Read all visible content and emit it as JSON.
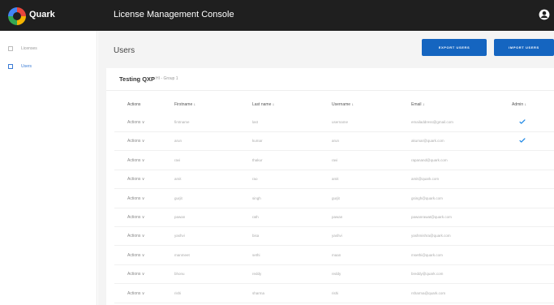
{
  "header": {
    "brand": "Quark",
    "title": "License Management Console"
  },
  "sidebar": {
    "items": [
      {
        "label": "Licenses"
      },
      {
        "label": "Users"
      }
    ]
  },
  "main": {
    "title": "Users",
    "export_label": "EXPORT USERS",
    "import_label": "IMPORT USERS"
  },
  "card": {
    "title": "Testing QXP",
    "subtitle": "HI - Group 1"
  },
  "table": {
    "columns": [
      "Actions",
      "Firstname ↓",
      "Last name ↓",
      "Username ↓",
      "Email ↓",
      "Admin ↓"
    ],
    "rows": [
      {
        "action": "Actions ∨",
        "first": "firstname",
        "last": "last",
        "user": "username",
        "email": "emailaddress@gmail.com",
        "admin": true
      },
      {
        "action": "Actions ∨",
        "first": "arun",
        "last": "kumar",
        "user": "arun",
        "email": "akumar@quark.com",
        "admin": true
      },
      {
        "action": "Actions ∨",
        "first": "ravi",
        "last": "thakur",
        "user": "ravi",
        "email": "rapanand@quark.com",
        "admin": false
      },
      {
        "action": "Actions ∨",
        "first": "amit",
        "last": "rao",
        "user": "amit",
        "email": "amit@quark.com",
        "admin": false
      },
      {
        "action": "Actions ∨",
        "first": "gurjit",
        "last": "singh",
        "user": "gurjit",
        "email": "gsingh@quark.com",
        "admin": false
      },
      {
        "action": "Actions ∨",
        "first": "pawan",
        "last": "rath",
        "user": "pawan",
        "email": "pawanrawat@quark.com",
        "admin": false
      },
      {
        "action": "Actions ∨",
        "first": "yashvi",
        "last": "bisa",
        "user": "yashvi",
        "email": "yashmishra@quark.com",
        "admin": false
      },
      {
        "action": "Actions ∨",
        "first": "manmeet",
        "last": "sethi",
        "user": "maan",
        "email": "msethi@quark.com",
        "admin": false
      },
      {
        "action": "Actions ∨",
        "first": "bhonu",
        "last": "reddy",
        "user": "reddy",
        "email": "breddy@quark.com",
        "admin": false
      },
      {
        "action": "Actions ∨",
        "first": "rishi",
        "last": "sharma",
        "user": "rishi",
        "email": "rsharma@quark.com",
        "admin": false
      }
    ]
  },
  "colors": {
    "topbar": "#1f1f1f",
    "accent": "#1565c0",
    "check": "#1e88e5"
  }
}
